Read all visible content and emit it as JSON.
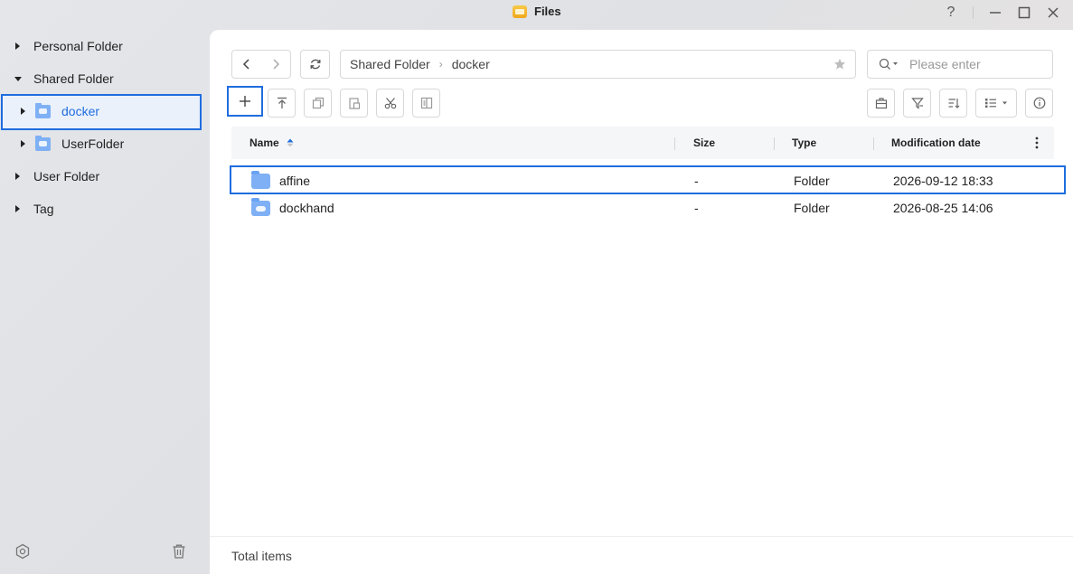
{
  "window": {
    "title": "Files",
    "help_icon": "help-icon",
    "minimize_icon": "minimize-icon",
    "maximize_icon": "maximize-icon",
    "close_icon": "close-icon"
  },
  "sidebar": {
    "items": [
      {
        "label": "Personal Folder",
        "expanded": false
      },
      {
        "label": "Shared Folder",
        "expanded": true
      },
      {
        "label": "docker",
        "selected": true
      },
      {
        "label": "UserFolder"
      },
      {
        "label": "User Folder",
        "expanded": false
      },
      {
        "label": "Tag",
        "expanded": false
      }
    ],
    "bottom_icons": [
      "settings-icon",
      "trash-icon"
    ]
  },
  "toolbar": {
    "back_icon": "chevron-left-icon",
    "forward_icon": "chevron-right-icon",
    "refresh_icon": "refresh-icon",
    "breadcrumb": [
      "Shared Folder",
      "docker"
    ],
    "favorite_icon": "star-icon",
    "search_placeholder": "Please enter",
    "actions": [
      "add-icon",
      "upload-icon",
      "copy-icon",
      "paste-icon",
      "cut-icon",
      "move-icon"
    ],
    "right_actions": [
      "toolbox-icon",
      "filter-icon",
      "sort-icon",
      "view-list-icon",
      "info-icon"
    ]
  },
  "table": {
    "columns": [
      "Name",
      "Size",
      "Type",
      "Modification date"
    ],
    "rows": [
      {
        "name": "affine",
        "size": "-",
        "type": "Folder",
        "date": "2026-09-12 18:33",
        "selected": true
      },
      {
        "name": "dockhand",
        "size": "-",
        "type": "Folder",
        "date": "2026-08-25 14:06",
        "selected": false
      }
    ]
  },
  "footer": {
    "total_label": "Total items"
  },
  "colors": {
    "accent": "#1f6ddf",
    "folder": "#7fb0f5"
  }
}
